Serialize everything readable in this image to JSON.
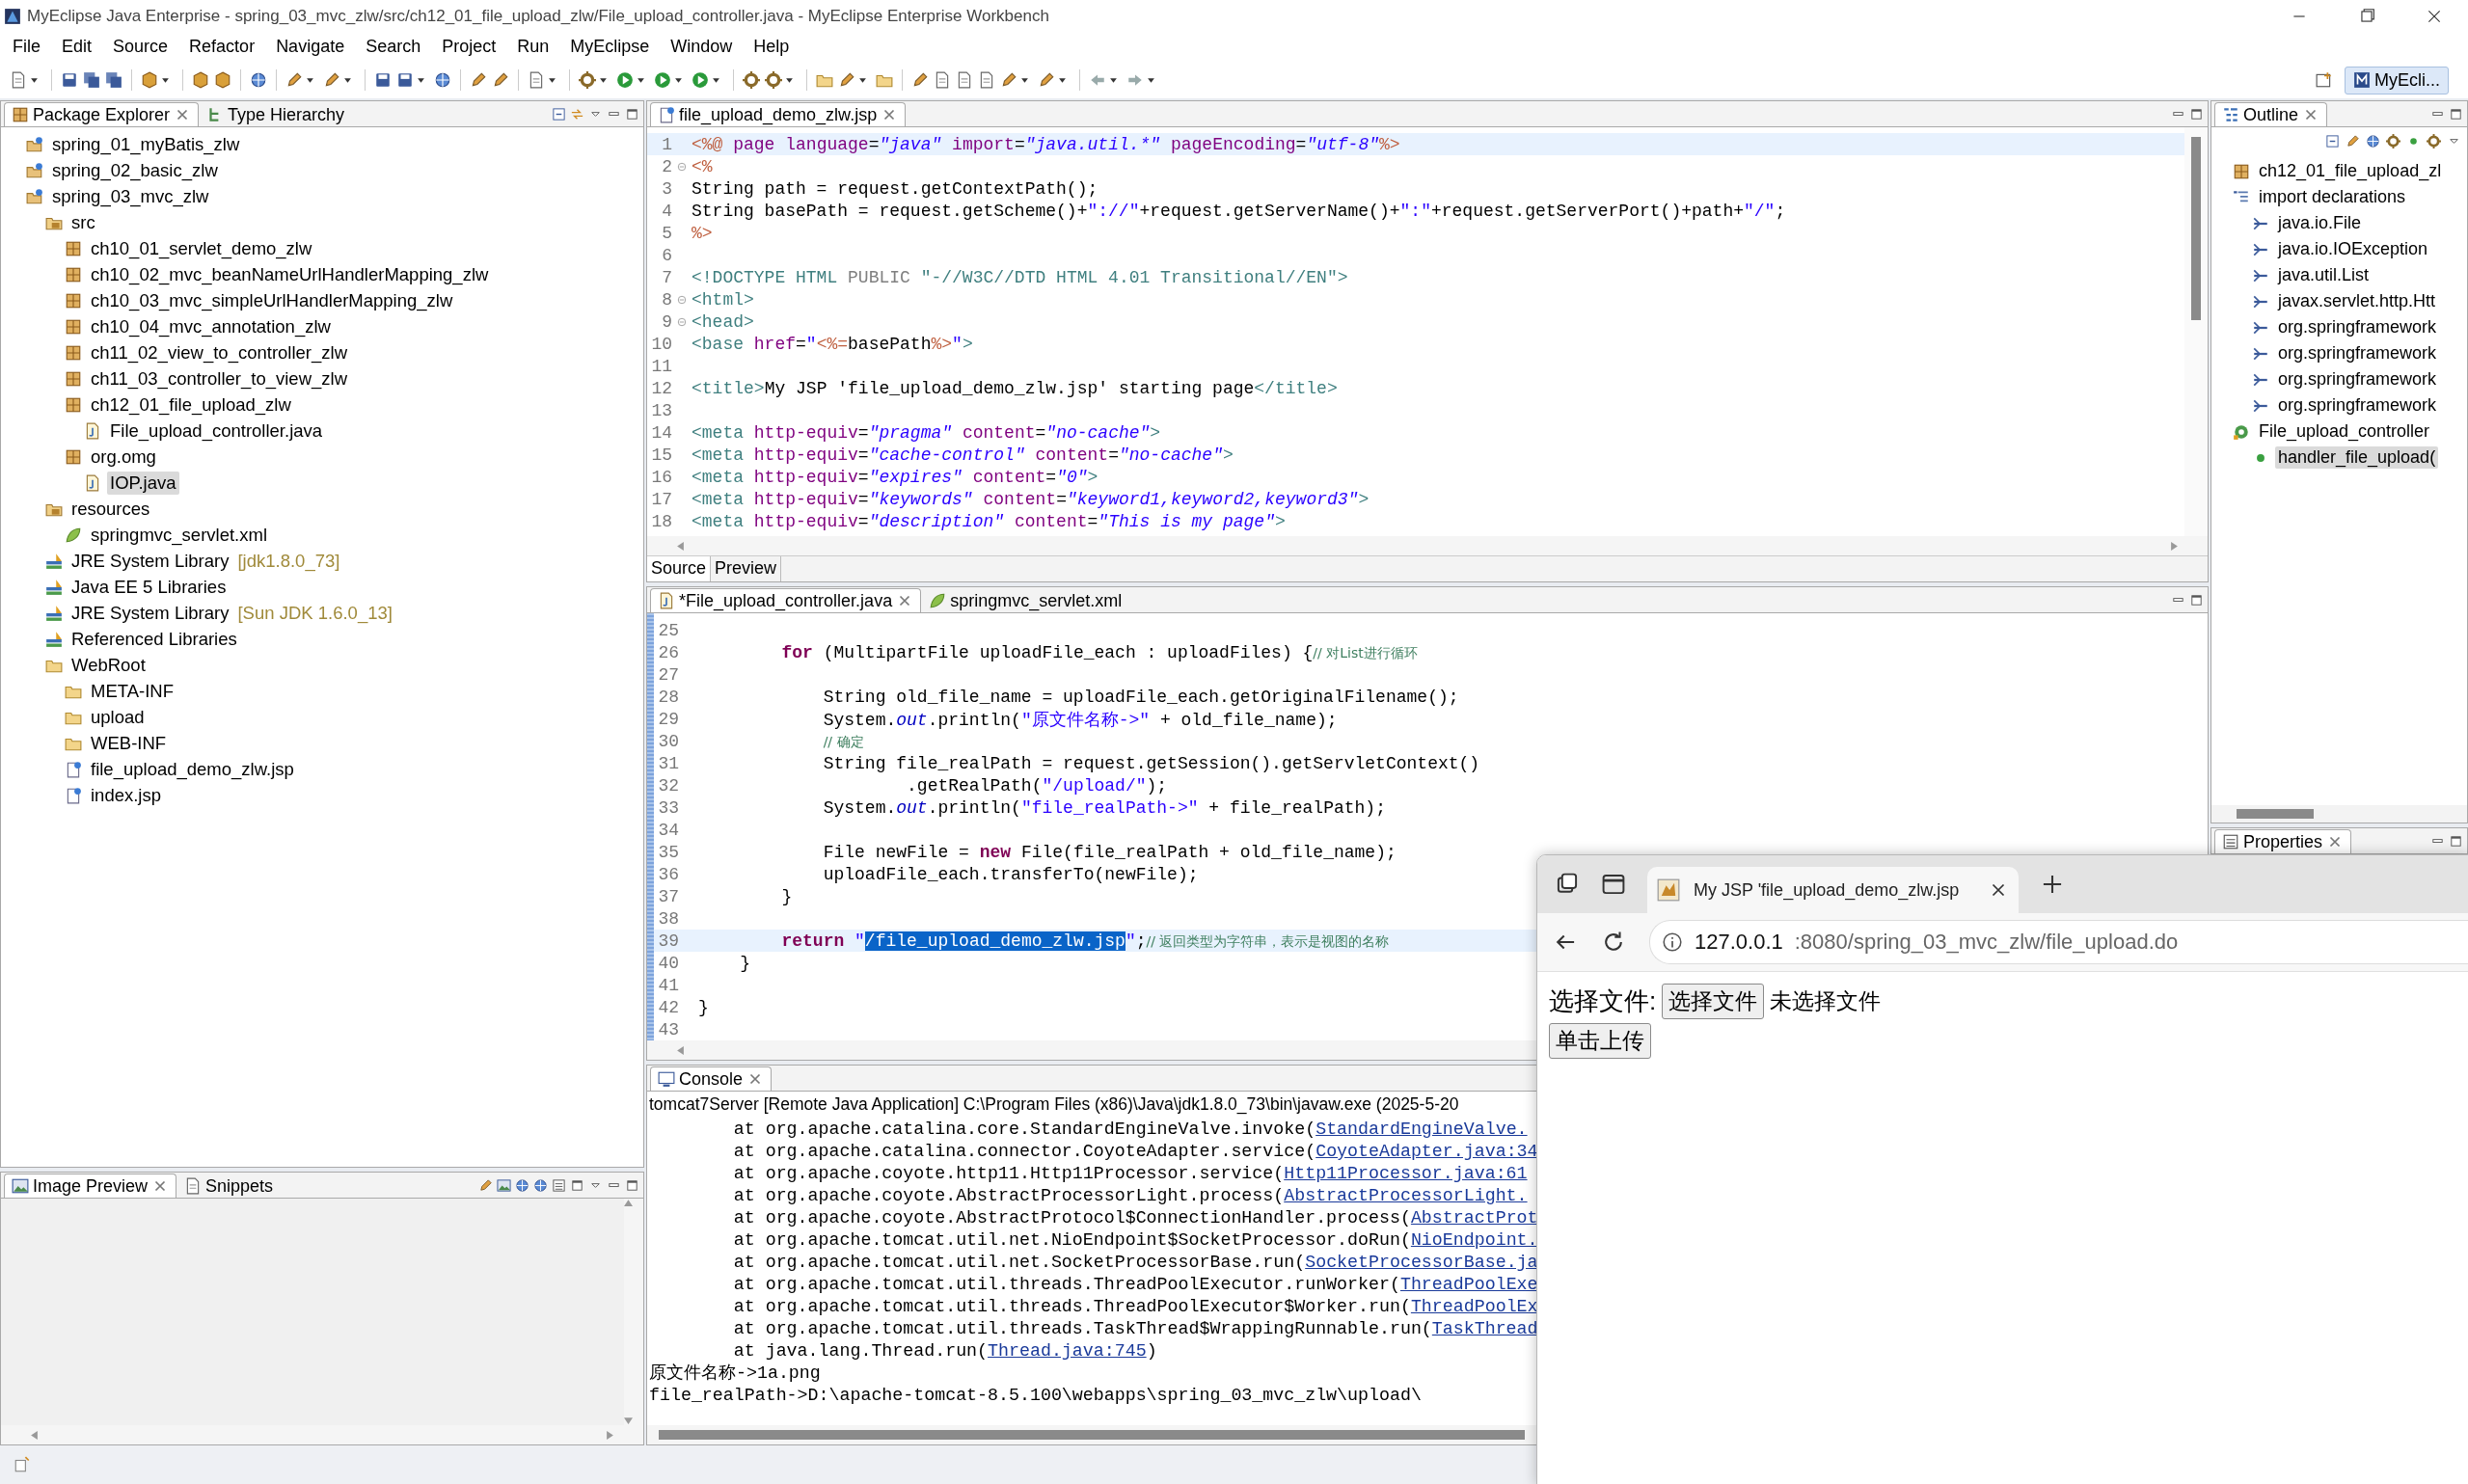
{
  "window": {
    "title": "MyEclipse Java Enterprise - spring_03_mvc_zlw/src/ch12_01_file_upload_zlw/File_upload_controller.java - MyEclipse Enterprise Workbench"
  },
  "menu": [
    "File",
    "Edit",
    "Source",
    "Refactor",
    "Navigate",
    "Search",
    "Project",
    "Run",
    "MyEclipse",
    "Window",
    "Help"
  ],
  "perspective": {
    "label": "MyEcli..."
  },
  "left_panel": {
    "tabs": [
      {
        "label": "Package Explorer",
        "selected": true
      },
      {
        "label": "Type Hierarchy",
        "selected": false
      }
    ],
    "tree": [
      {
        "label": "spring_01_myBatis_zlw",
        "kind": "project",
        "selected": false
      },
      {
        "label": "spring_02_basic_zlw",
        "kind": "project",
        "selected": false
      },
      {
        "label": "spring_03_mvc_zlw",
        "kind": "project",
        "selected": false,
        "children": [
          {
            "label": "src",
            "kind": "srcfolder",
            "selected": false,
            "children": [
              {
                "label": "ch10_01_servlet_demo_zlw",
                "kind": "package",
                "selected": false
              },
              {
                "label": "ch10_02_mvc_beanNameUrlHandlerMapping_zlw",
                "kind": "package",
                "selected": false
              },
              {
                "label": "ch10_03_mvc_simpleUrlHandlerMapping_zlw",
                "kind": "package",
                "selected": false
              },
              {
                "label": "ch10_04_mvc_annotation_zlw",
                "kind": "package",
                "selected": false
              },
              {
                "label": "ch11_02_view_to_controller_zlw",
                "kind": "package",
                "selected": false
              },
              {
                "label": "ch11_03_controller_to_view_zlw",
                "kind": "package",
                "selected": false
              },
              {
                "label": "ch12_01_file_upload_zlw",
                "kind": "package",
                "selected": false,
                "children": [
                  {
                    "label": "File_upload_controller.java",
                    "kind": "java",
                    "selected": false
                  }
                ]
              },
              {
                "label": "org.omg",
                "kind": "package",
                "selected": false,
                "children": [
                  {
                    "label": "IOP.java",
                    "kind": "java",
                    "selected": true
                  }
                ]
              }
            ]
          },
          {
            "label": "resources",
            "kind": "srcfolder",
            "selected": false,
            "children": [
              {
                "label": "springmvc_servlet.xml",
                "kind": "xml",
                "selected": false
              }
            ]
          },
          {
            "label": "JRE System Library",
            "decoration": "[jdk1.8.0_73]",
            "kind": "library",
            "selected": false
          },
          {
            "label": "Java EE 5 Libraries",
            "kind": "library",
            "selected": false
          },
          {
            "label": "JRE System Library",
            "decoration": "[Sun JDK 1.6.0_13]",
            "kind": "library",
            "selected": false
          },
          {
            "label": "Referenced Libraries",
            "kind": "library",
            "selected": false
          },
          {
            "label": "WebRoot",
            "kind": "folder",
            "selected": false,
            "children": [
              {
                "label": "META-INF",
                "kind": "folder",
                "selected": false
              },
              {
                "label": "upload",
                "kind": "folder",
                "selected": false
              },
              {
                "label": "WEB-INF",
                "kind": "folder",
                "selected": false
              },
              {
                "label": "file_upload_demo_zlw.jsp",
                "kind": "jsp",
                "selected": false
              },
              {
                "label": "index.jsp",
                "kind": "jsp",
                "selected": false
              }
            ]
          }
        ]
      }
    ]
  },
  "image_panel": {
    "tabs": [
      {
        "label": "Image Preview",
        "selected": true
      },
      {
        "label": "Snippets",
        "selected": false
      }
    ]
  },
  "jsp_editor": {
    "tabs": [
      {
        "label": "file_upload_demo_zlw.jsp",
        "selected": true
      }
    ],
    "lines": [
      {
        "number": "1",
        "current": true,
        "tokens": [
          {
            "kind": "delim",
            "text": "<%@"
          },
          {
            "kind": "attr",
            "text": " page language"
          },
          {
            "kind": "plain",
            "text": "="
          },
          {
            "kind": "value",
            "text": "\"java\""
          },
          {
            "kind": "attr",
            "text": " import"
          },
          {
            "kind": "plain",
            "text": "="
          },
          {
            "kind": "value",
            "text": "\"java.util.*\""
          },
          {
            "kind": "attr",
            "text": " pageEncoding"
          },
          {
            "kind": "plain",
            "text": "="
          },
          {
            "kind": "value",
            "text": "\"utf-8\""
          },
          {
            "kind": "delim",
            "text": "%>"
          }
        ]
      },
      {
        "number": "2",
        "fold": true,
        "tokens": [
          {
            "kind": "delim",
            "text": "<%"
          }
        ]
      },
      {
        "number": "3",
        "tokens": [
          {
            "kind": "plain",
            "text": "String path = request.getContextPath();"
          }
        ]
      },
      {
        "number": "4",
        "tokens": [
          {
            "kind": "plain",
            "text": "String basePath = request.getScheme()+"
          },
          {
            "kind": "string",
            "text": "\"://\""
          },
          {
            "kind": "plain",
            "text": "+request.getServerName()+"
          },
          {
            "kind": "string",
            "text": "\":\""
          },
          {
            "kind": "plain",
            "text": "+request.getServerPort()+path+"
          },
          {
            "kind": "string",
            "text": "\"/\""
          },
          {
            "kind": "plain",
            "text": ";"
          }
        ]
      },
      {
        "number": "5",
        "tokens": [
          {
            "kind": "delim",
            "text": "%>"
          }
        ]
      },
      {
        "number": "6"
      },
      {
        "number": "7",
        "tokens": [
          {
            "kind": "tag",
            "text": "<!DOCTYPE HTML "
          },
          {
            "kind": "muted",
            "text": "PUBLIC"
          },
          {
            "kind": "tag",
            "text": " \"-//W3C//DTD HTML 4.01 Transitional//EN\">"
          }
        ]
      },
      {
        "number": "8",
        "fold": true,
        "tokens": [
          {
            "kind": "tag",
            "text": "<html>"
          }
        ]
      },
      {
        "number": "9",
        "fold": true,
        "tokens": [
          {
            "kind": "tag",
            "text": "<head>"
          }
        ]
      },
      {
        "number": "10",
        "tokens": [
          {
            "kind": "tag",
            "text": "<base "
          },
          {
            "kind": "attr",
            "text": "href"
          },
          {
            "kind": "plain",
            "text": "="
          },
          {
            "kind": "string",
            "text": "\""
          },
          {
            "kind": "delim",
            "text": "<%="
          },
          {
            "kind": "plain",
            "text": "basePath"
          },
          {
            "kind": "delim",
            "text": "%>"
          },
          {
            "kind": "string",
            "text": "\""
          },
          {
            "kind": "tag",
            "text": ">"
          }
        ]
      },
      {
        "number": "11"
      },
      {
        "number": "12",
        "tokens": [
          {
            "kind": "tag",
            "text": "<title>"
          },
          {
            "kind": "plain",
            "text": "My JSP 'file_upload_demo_zlw.jsp' starting page"
          },
          {
            "kind": "tag",
            "text": "</title>"
          }
        ]
      },
      {
        "number": "13"
      },
      {
        "number": "14",
        "tokens": [
          {
            "kind": "tag",
            "text": "<meta "
          },
          {
            "kind": "attr",
            "text": "http-equiv"
          },
          {
            "kind": "plain",
            "text": "="
          },
          {
            "kind": "value",
            "text": "\"pragma\""
          },
          {
            "kind": "attr",
            "text": " content"
          },
          {
            "kind": "plain",
            "text": "="
          },
          {
            "kind": "value",
            "text": "\"no-cache\""
          },
          {
            "kind": "tag",
            "text": ">"
          }
        ]
      },
      {
        "number": "15",
        "tokens": [
          {
            "kind": "tag",
            "text": "<meta "
          },
          {
            "kind": "attr",
            "text": "http-equiv"
          },
          {
            "kind": "plain",
            "text": "="
          },
          {
            "kind": "value",
            "text": "\"cache-control\""
          },
          {
            "kind": "attr",
            "text": " content"
          },
          {
            "kind": "plain",
            "text": "="
          },
          {
            "kind": "value",
            "text": "\"no-cache\""
          },
          {
            "kind": "tag",
            "text": ">"
          }
        ]
      },
      {
        "number": "16",
        "tokens": [
          {
            "kind": "tag",
            "text": "<meta "
          },
          {
            "kind": "attr",
            "text": "http-equiv"
          },
          {
            "kind": "plain",
            "text": "="
          },
          {
            "kind": "value",
            "text": "\"expires\""
          },
          {
            "kind": "attr",
            "text": " content"
          },
          {
            "kind": "plain",
            "text": "="
          },
          {
            "kind": "value",
            "text": "\"0\""
          },
          {
            "kind": "tag",
            "text": ">"
          }
        ]
      },
      {
        "number": "17",
        "tokens": [
          {
            "kind": "tag",
            "text": "<meta "
          },
          {
            "kind": "attr",
            "text": "http-equiv"
          },
          {
            "kind": "plain",
            "text": "="
          },
          {
            "kind": "value",
            "text": "\"keywords\""
          },
          {
            "kind": "attr",
            "text": " content"
          },
          {
            "kind": "plain",
            "text": "="
          },
          {
            "kind": "value",
            "text": "\"keyword1,keyword2,keyword3\""
          },
          {
            "kind": "tag",
            "text": ">"
          }
        ]
      },
      {
        "number": "18",
        "tokens": [
          {
            "kind": "tag",
            "text": "<meta "
          },
          {
            "kind": "attr",
            "text": "http-equiv"
          },
          {
            "kind": "plain",
            "text": "="
          },
          {
            "kind": "value",
            "text": "\"description\""
          },
          {
            "kind": "attr",
            "text": " content"
          },
          {
            "kind": "plain",
            "text": "="
          },
          {
            "kind": "value",
            "text": "\"This is my page\""
          },
          {
            "kind": "tag",
            "text": ">"
          }
        ]
      }
    ],
    "view_tabs": [
      {
        "label": "Source",
        "selected": true
      },
      {
        "label": "Preview",
        "selected": false
      }
    ]
  },
  "java_editor": {
    "tabs": [
      {
        "label": "*File_upload_controller.java",
        "selected": true
      },
      {
        "label": "springmvc_servlet.xml",
        "selected": false
      }
    ],
    "lines": [
      {
        "number": "25"
      },
      {
        "number": "26",
        "tokens": [
          {
            "kind": "keyword",
            "text": "        for"
          },
          {
            "kind": "plain",
            "text": " (MultipartFile uploadFile_each : uploadFiles) {"
          },
          {
            "kind": "comment",
            "text": "// 对List进行循环"
          }
        ]
      },
      {
        "number": "27"
      },
      {
        "number": "28",
        "tokens": [
          {
            "kind": "plain",
            "text": "            String old_file_name = uploadFile_each.getOriginalFilename();"
          }
        ]
      },
      {
        "number": "29",
        "tokens": [
          {
            "kind": "plain",
            "text": "            System."
          },
          {
            "kind": "field",
            "text": "out"
          },
          {
            "kind": "plain",
            "text": ".println("
          },
          {
            "kind": "string",
            "text": "\"原文件名称->\""
          },
          {
            "kind": "plain",
            "text": " + old_file_name);"
          }
        ]
      },
      {
        "number": "30",
        "tokens": [
          {
            "kind": "comment",
            "text": "            // 确定"
          }
        ]
      },
      {
        "number": "31",
        "tokens": [
          {
            "kind": "plain",
            "text": "            String file_realPath = request.getSession().getServletContext()"
          }
        ]
      },
      {
        "number": "32",
        "tokens": [
          {
            "kind": "plain",
            "text": "                    .getRealPath("
          },
          {
            "kind": "string",
            "text": "\"/upload/\""
          },
          {
            "kind": "plain",
            "text": ");"
          }
        ]
      },
      {
        "number": "33",
        "tokens": [
          {
            "kind": "plain",
            "text": "            System."
          },
          {
            "kind": "field",
            "text": "out"
          },
          {
            "kind": "plain",
            "text": ".println("
          },
          {
            "kind": "string",
            "text": "\"file_realPath->\""
          },
          {
            "kind": "plain",
            "text": " + file_realPath);"
          }
        ]
      },
      {
        "number": "34"
      },
      {
        "number": "35",
        "tokens": [
          {
            "kind": "plain",
            "text": "            File newFile = "
          },
          {
            "kind": "keyword",
            "text": "new"
          },
          {
            "kind": "plain",
            "text": " File(file_realPath + old_file_name);"
          }
        ]
      },
      {
        "number": "36",
        "tokens": [
          {
            "kind": "plain",
            "text": "            uploadFile_each.transferTo(newFile);"
          }
        ]
      },
      {
        "number": "37",
        "tokens": [
          {
            "kind": "plain",
            "text": "        }"
          }
        ]
      },
      {
        "number": "38"
      },
      {
        "number": "39",
        "current": true,
        "tokens": [
          {
            "kind": "keyword",
            "text": "        return"
          },
          {
            "kind": "string",
            "text": " \""
          },
          {
            "kind": "selected",
            "text": "/file_upload_demo_zlw.jsp"
          },
          {
            "kind": "string",
            "text": "\""
          },
          {
            "kind": "plain",
            "text": ";"
          },
          {
            "kind": "comment",
            "text": "// 返回类型为字符串，表示是视图的名称"
          }
        ]
      },
      {
        "number": "40",
        "tokens": [
          {
            "kind": "plain",
            "text": "    }"
          }
        ]
      },
      {
        "number": "41"
      },
      {
        "number": "42",
        "tokens": [
          {
            "kind": "plain",
            "text": "}"
          }
        ]
      },
      {
        "number": "43"
      }
    ]
  },
  "console": {
    "tabs": [
      {
        "label": "Console",
        "selected": true
      }
    ],
    "process": "tomcat7Server [Remote Java Application] C:\\Program Files (x86)\\Java\\jdk1.8.0_73\\bin\\javaw.exe (2025-5-20",
    "lines": [
      {
        "text": "\tat org.apache.catalina.core.StandardEngineValve.invoke(",
        "link": "StandardEngineValve."
      },
      {
        "text": "\tat org.apache.catalina.connector.CoyoteAdapter.service(",
        "link": "CoyoteAdapter.java:34"
      },
      {
        "text": "\tat org.apache.coyote.http11.Http11Processor.service(",
        "link": "Http11Processor.java:61"
      },
      {
        "text": "\tat org.apache.coyote.AbstractProcessorLight.process(",
        "link": "AbstractProcessorLight."
      },
      {
        "text": "\tat org.apache.coyote.AbstractProtocol$ConnectionHandler.process(",
        "link": "AbstractProt"
      },
      {
        "text": "\tat org.apache.tomcat.util.net.NioEndpoint$SocketProcessor.doRun(",
        "link": "NioEndpoint."
      },
      {
        "text": "\tat org.apache.tomcat.util.net.SocketProcessorBase.run(",
        "link": "SocketProcessorBase.ja"
      },
      {
        "text": "\tat org.apache.tomcat.util.threads.ThreadPoolExecutor.runWorker(",
        "link": "ThreadPoolExe"
      },
      {
        "text": "\tat org.apache.tomcat.util.threads.ThreadPoolExecutor$Worker.run(",
        "link": "ThreadPoolEx"
      },
      {
        "text": "\tat org.apache.tomcat.util.threads.TaskThread$WrappingRunnable.run(",
        "link": "TaskThread"
      },
      {
        "text": "\tat java.lang.Thread.run(",
        "link": "Thread.java:745",
        "after": ")"
      },
      {
        "text": "原文件名称->1a.png"
      },
      {
        "text": "file_realPath->D:\\apache-tomcat-8.5.100\\webapps\\spring_03_mvc_zlw\\upload\\"
      }
    ]
  },
  "outline": {
    "tabs": [
      {
        "label": "Outline",
        "selected": true
      }
    ],
    "tree": [
      {
        "label": "ch12_01_file_upload_zl",
        "kind": "package",
        "selected": false
      },
      {
        "label": "import declarations",
        "kind": "imports",
        "selected": false,
        "children": [
          {
            "label": "java.io.File",
            "kind": "import",
            "selected": false
          },
          {
            "label": "java.io.IOException",
            "kind": "import",
            "selected": false
          },
          {
            "label": "java.util.List",
            "kind": "import",
            "selected": false
          },
          {
            "label": "javax.servlet.http.Htt",
            "kind": "import",
            "selected": false
          },
          {
            "label": "org.springframework",
            "kind": "import",
            "selected": false
          },
          {
            "label": "org.springframework",
            "kind": "import",
            "selected": false
          },
          {
            "label": "org.springframework",
            "kind": "import",
            "selected": false
          },
          {
            "label": "org.springframework",
            "kind": "import",
            "selected": false
          }
        ]
      },
      {
        "label": "File_upload_controller",
        "kind": "class",
        "selected": false,
        "children": [
          {
            "label": "handler_file_upload(",
            "kind": "method",
            "selected": true
          }
        ]
      }
    ]
  },
  "properties": {
    "tabs": [
      {
        "label": "Properties",
        "selected": true
      }
    ]
  },
  "browser": {
    "tab_title": "My JSP 'file_upload_demo_zlw.jsp",
    "url": {
      "host": "127.0.0.1",
      "path": ":8080/spring_03_mvc_zlw/file_upload.do"
    },
    "form": {
      "label": "选择文件:",
      "choose_button": "选择文件",
      "file_status": "未选择文件",
      "submit_button": "单击上传"
    }
  }
}
